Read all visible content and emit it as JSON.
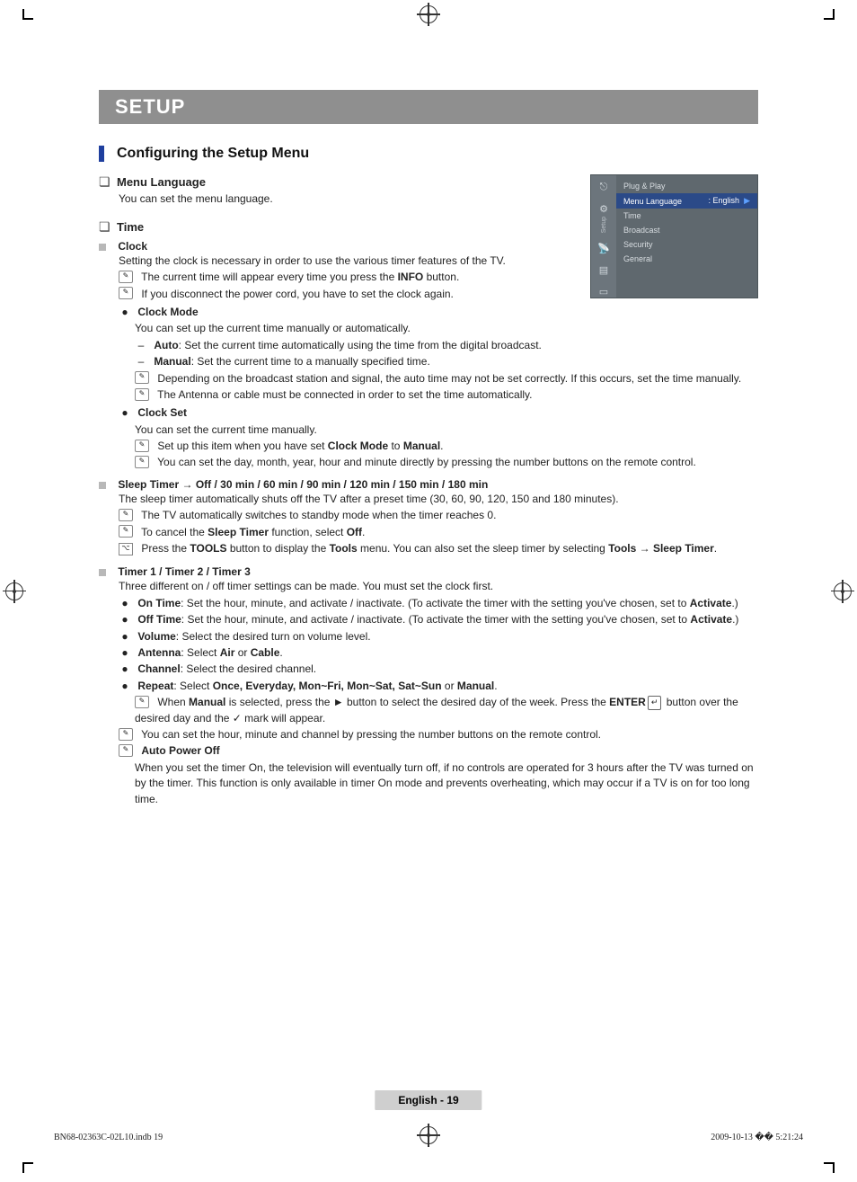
{
  "banner": "SETUP",
  "section_title": "Configuring the Setup Menu",
  "osd": {
    "items": [
      "Plug & Play",
      "Menu Language",
      "Time",
      "Broadcast",
      "Security",
      "General"
    ],
    "selected_value": ": English",
    "arrow": "▶"
  },
  "menu_language": {
    "title": "Menu Language",
    "desc": "You can set the menu language."
  },
  "time": {
    "title": "Time",
    "clock": {
      "title": "Clock",
      "desc": "Setting the clock is necessary in order to use the various timer features of the TV.",
      "note1_pre": "The current time will appear every time you press the ",
      "note1_bold": "INFO",
      "note1_post": " button.",
      "note2": "If you disconnect the power cord, you have to set the clock again.",
      "clock_mode": {
        "title": "Clock Mode",
        "desc": "You can set up the current time manually or automatically.",
        "auto_label": "Auto",
        "auto_desc": ": Set the current time automatically using the time from the digital broadcast.",
        "manual_label": "Manual",
        "manual_desc": ": Set the current time to a manually specified time.",
        "note_depend": "Depending on the broadcast station and signal, the auto time may not be set correctly. If this occurs, set the time manually.",
        "note_antenna": "The Antenna or cable must be connected in order to set the time automatically."
      },
      "clock_set": {
        "title": "Clock Set",
        "desc": "You can set the current time manually.",
        "note1_pre": "Set up this item when you have set ",
        "note1_b1": "Clock Mode",
        "note1_mid": " to ",
        "note1_b2": "Manual",
        "note1_post": ".",
        "note2": "You can set the day, month, year, hour and minute directly by pressing the number buttons on the remote control."
      }
    },
    "sleep": {
      "title_pre": "Sleep Timer ",
      "title_arrow": "→",
      "title_post": " Off / 30 min / 60 min / 90 min / 120 min / 150 min / 180 min",
      "desc": "The sleep timer automatically shuts off the TV after a preset time (30, 60, 90, 120, 150 and 180 minutes).",
      "note1": "The TV automatically switches to standby mode when the timer reaches 0.",
      "note2_pre": "To cancel the ",
      "note2_b1": "Sleep Timer",
      "note2_mid": " function, select ",
      "note2_b2": "Off",
      "note2_post": ".",
      "tools_pre": "Press the ",
      "tools_b1": "TOOLS",
      "tools_mid": " button to display the ",
      "tools_b2": "Tools",
      "tools_post1": " menu. You can also set the sleep timer by selecting ",
      "tools_b3": "Tools",
      "tools_arrow": " → ",
      "tools_b4": "Sleep Timer",
      "tools_post2": "."
    },
    "timer": {
      "title": "Timer 1 / Timer 2 / Timer 3",
      "desc": "Three different on / off timer settings can be made. You must set the clock first.",
      "on_time_label": "On Time",
      "on_time_desc_pre": ": Set the hour, minute, and activate / inactivate. (To activate the timer with the setting you've chosen, set to ",
      "on_time_b": "Activate",
      "on_time_desc_post": ".)",
      "off_time_label": "Off Time",
      "off_time_desc_pre": ": Set the hour, minute, and activate / inactivate. (To activate the timer with the setting you've chosen, set to ",
      "off_time_b": "Activate",
      "off_time_desc_post": ".)",
      "volume_label": "Volume",
      "volume_desc": ": Select the desired turn on volume level.",
      "antenna_label": "Antenna",
      "antenna_pre": ": Select ",
      "antenna_b1": "Air",
      "antenna_or": " or ",
      "antenna_b2": "Cable",
      "antenna_post": ".",
      "channel_label": "Channel",
      "channel_desc": ": Select the desired channel.",
      "repeat_label": "Repeat",
      "repeat_pre": ": Select ",
      "repeat_b": "Once, Everyday, Mon~Fri, Mon~Sat, Sat~Sun",
      "repeat_or": " or ",
      "repeat_b2": "Manual",
      "repeat_post": ".",
      "repeat_note_pre": "When ",
      "repeat_note_b1": "Manual",
      "repeat_note_mid1": " is selected, press the ",
      "repeat_note_arrow": "►",
      "repeat_note_mid2": " button to select the desired day of the week. Press the ",
      "repeat_note_b2": "ENTER",
      "repeat_note_mid3": " button over the desired day and the ",
      "repeat_note_check": "✓",
      "repeat_note_post": " mark will appear.",
      "note_hour": "You can set the hour, minute and channel by pressing the number buttons on the remote control.",
      "autopwr_label": "Auto Power Off",
      "autopwr_desc": "When you set the timer On, the television will eventually turn off, if no controls are operated for 3 hours after the TV was turned on by the timer. This function is only available in timer On mode and prevents overheating, which may occur if a TV is on for too long time."
    }
  },
  "footer": "English - 19",
  "print": {
    "left": "BN68-02363C-02L10.indb   19",
    "right": "2009-10-13   �� 5:21:24"
  }
}
